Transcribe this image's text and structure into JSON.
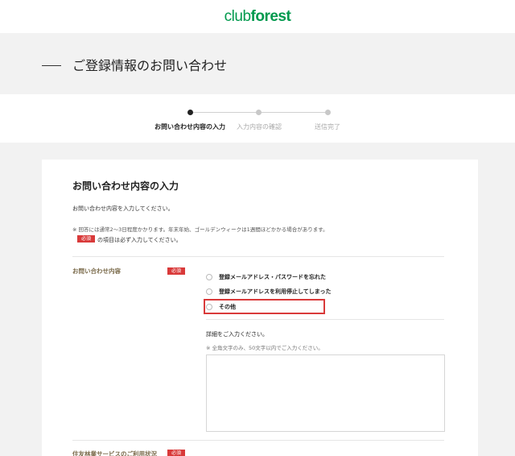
{
  "header": {
    "logo_club": "club",
    "logo_forest": "forest"
  },
  "page_title": "ご登録情報のお問い合わせ",
  "steps": [
    {
      "label": "お問い合わせ内容の入力",
      "active": true
    },
    {
      "label": "入力内容の確認",
      "active": false
    },
    {
      "label": "送信完了",
      "active": false
    }
  ],
  "form": {
    "section_title": "お問い合わせ内容の入力",
    "intro": "お問い合わせ内容を入力してください。",
    "note": "※ 回答には通常2〜3日程度かかります。年末年始、ゴールデンウィークは1週間ほどかかる場合があります。",
    "required_badge": "必須",
    "required_note": "の項目は必ず入力してください。",
    "inquiry_field": {
      "label": "お問い合わせ内容",
      "options": [
        {
          "label": "登録メールアドレス・パスワードを忘れた",
          "checked": false
        },
        {
          "label": "登録メールアドレスを利用停止してしまった",
          "checked": false
        },
        {
          "label": "その他",
          "checked": false
        }
      ]
    },
    "detail": {
      "label": "詳細をご入力ください。",
      "hint": "※ 全角文字のみ、50文字以内でご入力ください。",
      "value": ""
    },
    "next_field": {
      "label": "住友林業サービスのご利用状況"
    }
  },
  "colors": {
    "brand": "#00994d",
    "required": "#d93a3a",
    "label": "#7a6a4a"
  }
}
